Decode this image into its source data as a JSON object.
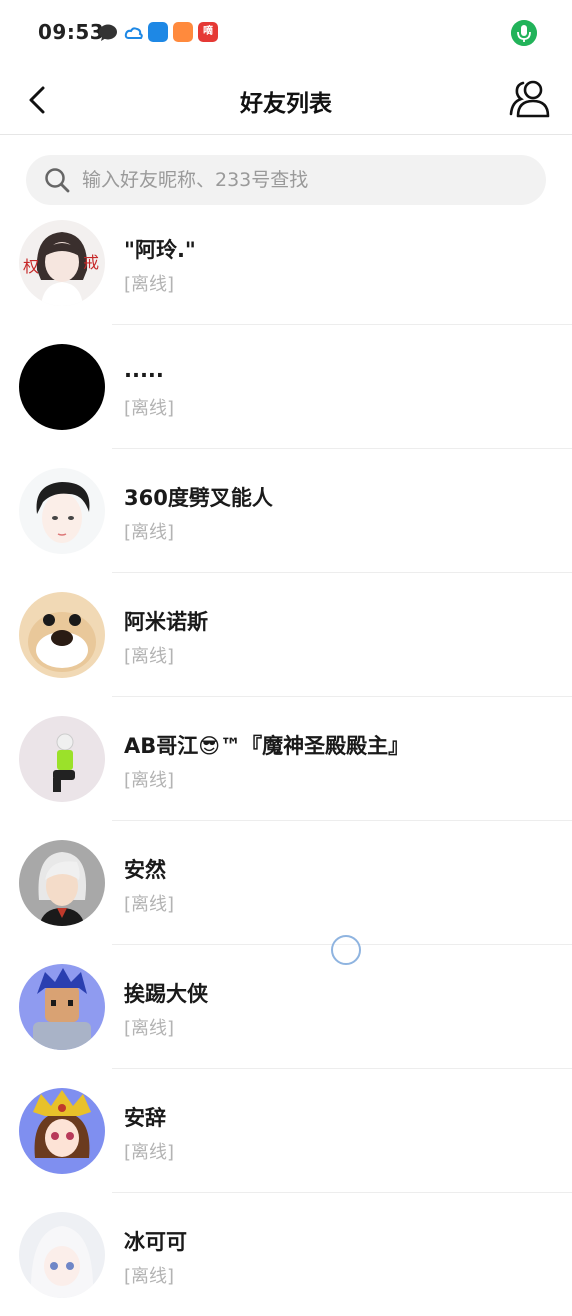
{
  "status_bar": {
    "time": "09:53",
    "app3_label": "嘀"
  },
  "header": {
    "title": "好友列表"
  },
  "search": {
    "placeholder": "输入好友昵称、233号查找",
    "value": ""
  },
  "friends": [
    {
      "name": "\"阿玲.\"",
      "status": "[离线]"
    },
    {
      "name": ".....",
      "status": "[离线]"
    },
    {
      "name": "360度劈叉能人",
      "status": "[离线]"
    },
    {
      "name": "阿米诺斯",
      "status": "[离线]"
    },
    {
      "name": "AB哥江😎™『魔神圣殿殿主』",
      "status": "[离线]"
    },
    {
      "name": "安然",
      "status": "[离线]"
    },
    {
      "name": "挨踢大侠",
      "status": "[离线]"
    },
    {
      "name": "安辞",
      "status": "[离线]"
    },
    {
      "name": "冰可可",
      "status": "[离线]"
    }
  ],
  "colors": {
    "status_offline": "#b3b3b3",
    "mic_green": "#22b35a",
    "search_bg": "#f2f2f2"
  }
}
